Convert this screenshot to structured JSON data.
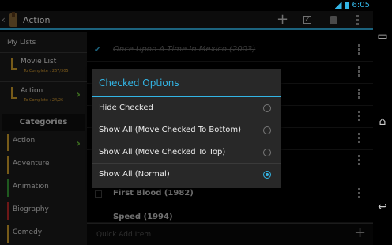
{
  "status": {
    "time": "6:05"
  },
  "actionbar": {
    "title": "Action",
    "back_glyph": "‹"
  },
  "sidebar": {
    "header": "My Lists",
    "lists": [
      {
        "name": "Movie List",
        "progress": "To Complete : 267/305"
      },
      {
        "name": "Action",
        "progress": "To Complete : 24/26"
      }
    ],
    "categories_header": "Categories",
    "categories": [
      {
        "name": "Action",
        "color": "#d9a62e",
        "selected": true
      },
      {
        "name": "Adventure",
        "color": "#d9a62e",
        "selected": false
      },
      {
        "name": "Animation",
        "color": "#3aa33a",
        "selected": false
      },
      {
        "name": "Biography",
        "color": "#c62a2a",
        "selected": false
      },
      {
        "name": "Comedy",
        "color": "#d9a62e",
        "selected": false
      }
    ]
  },
  "main": {
    "rows": [
      {
        "title": "Once Upon A Time In Mexico (2003)",
        "checked": true
      },
      {
        "title": "First Blood (1982)",
        "checked": false
      },
      {
        "title": "Speed (1994)",
        "checked": false
      }
    ],
    "quick_add_placeholder": "Quick Add Item"
  },
  "dialog": {
    "title": "Checked Options",
    "options": [
      {
        "label": "Hide Checked",
        "selected": false
      },
      {
        "label": "Show All (Move Checked To Bottom)",
        "selected": false
      },
      {
        "label": "Show All (Move Checked To Top)",
        "selected": false
      },
      {
        "label": "Show All (Normal)",
        "selected": true
      }
    ]
  },
  "colors": {
    "accent": "#33b5e5",
    "progress": "#e8a832",
    "chevron": "#6ec43a"
  },
  "icons": [
    "back-icon",
    "app-logo-icon",
    "add-icon",
    "checkbox-icon",
    "database-icon",
    "overflow-menu-icon",
    "wifi-icon",
    "battery-icon",
    "home-icon",
    "nav-back-icon",
    "recents-icon",
    "check-icon",
    "chevron-right-icon"
  ]
}
